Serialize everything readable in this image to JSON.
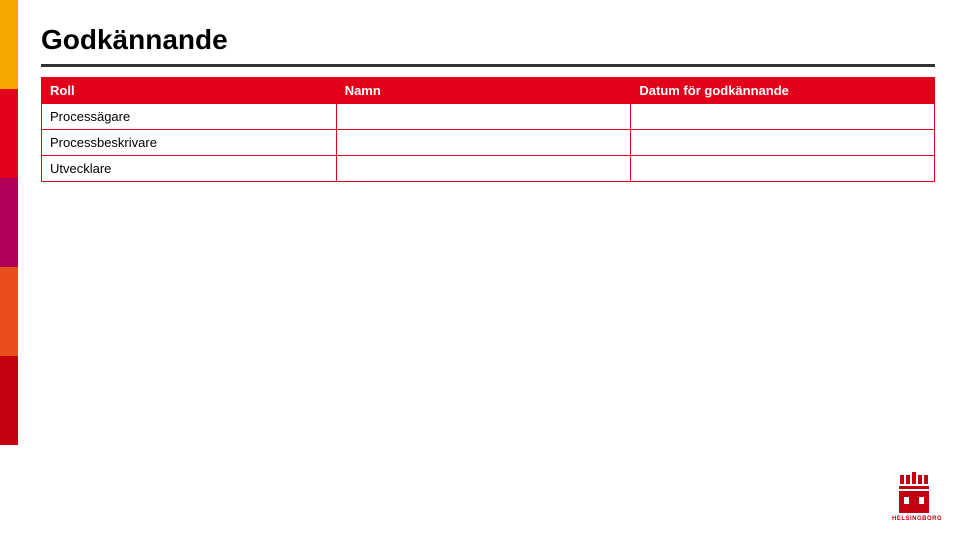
{
  "title": "Godkännande",
  "table": {
    "headers": {
      "roll": "Roll",
      "namn": "Namn",
      "datum": "Datum för godkännande"
    },
    "rows": [
      {
        "roll": "Processägare",
        "namn": "",
        "datum": ""
      },
      {
        "roll": "Processbeskrivare",
        "namn": "",
        "datum": ""
      },
      {
        "roll": "Utvecklare",
        "namn": "",
        "datum": ""
      }
    ]
  },
  "sidebar_colors": [
    "#f7a600",
    "#e2001a",
    "#b10059",
    "#e94e1b",
    "#c2000f"
  ],
  "logo": {
    "text": "HELSINGBORG"
  }
}
